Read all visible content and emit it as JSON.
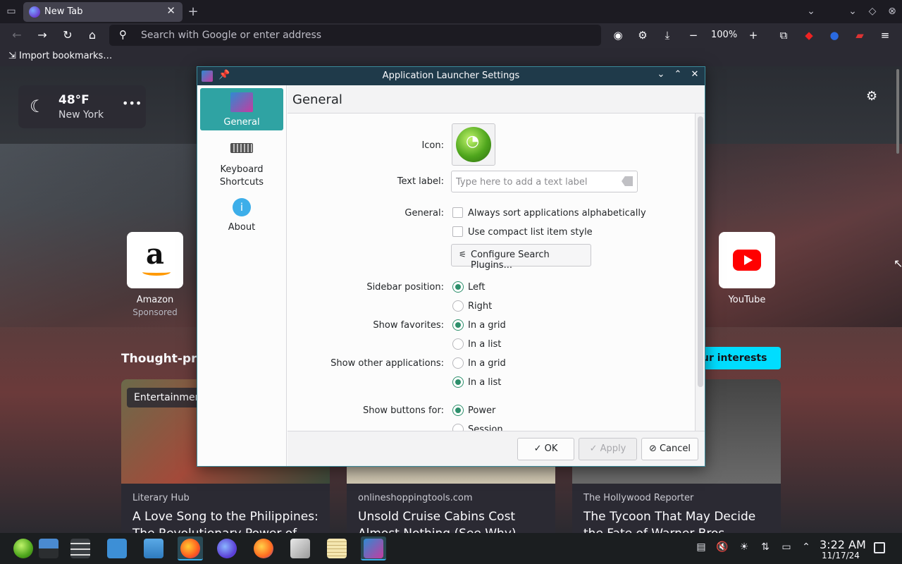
{
  "browser": {
    "tab": {
      "title": "New Tab",
      "close": "✕"
    },
    "new_tab_btn": "+",
    "url_placeholder": "Search with Google or enter address",
    "zoom": "100%",
    "bookmarks_label": "Import bookmarks…"
  },
  "newtab": {
    "weather": {
      "temp": "48°F",
      "city": "New York",
      "more": "•••"
    },
    "shortcuts": [
      {
        "label": "Amazon",
        "sub": "Sponsored",
        "icon": "amazon-icon"
      },
      {
        "label": "YouTube",
        "sub": "",
        "icon": "youtube-icon"
      }
    ],
    "stories_heading": "Thought-pro",
    "interests_btn": "ur interests",
    "cards": [
      {
        "tag": "Entertainmen",
        "source": "Literary Hub",
        "title": "A Love Song to the Philippines: The Revolutionary Power of"
      },
      {
        "tag": "",
        "source": "onlineshoppingtools.com",
        "title": "Unsold Cruise Cabins Cost Almost Nothing (See Why)"
      },
      {
        "tag": "",
        "source": "The Hollywood Reporter",
        "title": "The Tycoon That May Decide the Fate of Warner Bros."
      }
    ]
  },
  "dialog": {
    "title": "Application Launcher Settings",
    "sidebar": [
      {
        "label": "General",
        "icon": "app-launcher-icon"
      },
      {
        "label": "Keyboard Shortcuts",
        "icon": "keyboard-icon"
      },
      {
        "label": "About",
        "icon": "info-icon"
      }
    ],
    "page_title": "General",
    "fields": {
      "icon_label": "Icon:",
      "text_label": "Text label:",
      "text_placeholder": "Type here to add a text label",
      "general_label": "General:",
      "sort_alpha": "Always sort applications alphabetically",
      "compact_list": "Use compact list item style",
      "configure_search": "Configure Search Plugins...",
      "sidebar_position_label": "Sidebar position:",
      "left": "Left",
      "right": "Right",
      "show_favorites_label": "Show favorites:",
      "in_grid": "In a grid",
      "in_list": "In a list",
      "show_other_label": "Show other applications:",
      "show_buttons_label": "Show buttons for:",
      "power": "Power",
      "session": "Session"
    },
    "state": {
      "sort_alpha": false,
      "compact_list": false,
      "sidebar_position": "Left",
      "show_favorites": "In a grid",
      "show_other": "In a list",
      "show_buttons": "Power"
    },
    "buttons": {
      "ok": "OK",
      "apply": "Apply",
      "cancel": "Cancel"
    }
  },
  "taskbar": {
    "time": "3:22 AM",
    "date": "11/17/24"
  },
  "colors": {
    "accent": "#2fa3a3",
    "radio_on": "#2d8f6b",
    "interests_btn": "#00ddff"
  }
}
